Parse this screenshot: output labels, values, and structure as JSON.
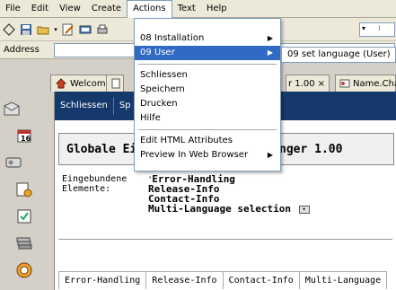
{
  "menubar": {
    "items": [
      "File",
      "Edit",
      "View",
      "Create",
      "Actions",
      "Text",
      "Help"
    ]
  },
  "address": {
    "label": "Address"
  },
  "tabs": [
    {
      "label": "Welcome"
    },
    {
      "label": "r 1.00"
    },
    {
      "label": "Name.Char"
    }
  ],
  "doc": {
    "toolbar": [
      "Schliessen",
      "Sp"
    ],
    "heading_left": "Globale Eir",
    "heading_right": "nger 1.00",
    "embedded_label": "Eingebundene\nElemente:",
    "embedded_items": [
      "Error-Handling",
      "Release-Info",
      "Contact-Info",
      "Multi-Language selection"
    ],
    "bottom_tabs": [
      "Error-Handling",
      "Release-Info",
      "Contact-Info",
      "Multi-Language"
    ]
  },
  "actions_menu": {
    "items": [
      {
        "label": "08 Installation",
        "submenu": true
      },
      {
        "label": "09 User",
        "submenu": true,
        "highlighted": true
      },
      {
        "label": "Schliessen"
      },
      {
        "label": "Speichern"
      },
      {
        "label": "Drucken"
      },
      {
        "label": "Hilfe"
      },
      {
        "label": "Edit HTML Attributes"
      },
      {
        "label": "Preview In Web Browser",
        "submenu": true
      }
    ]
  },
  "submenu": {
    "label": "09 set language (User)"
  }
}
